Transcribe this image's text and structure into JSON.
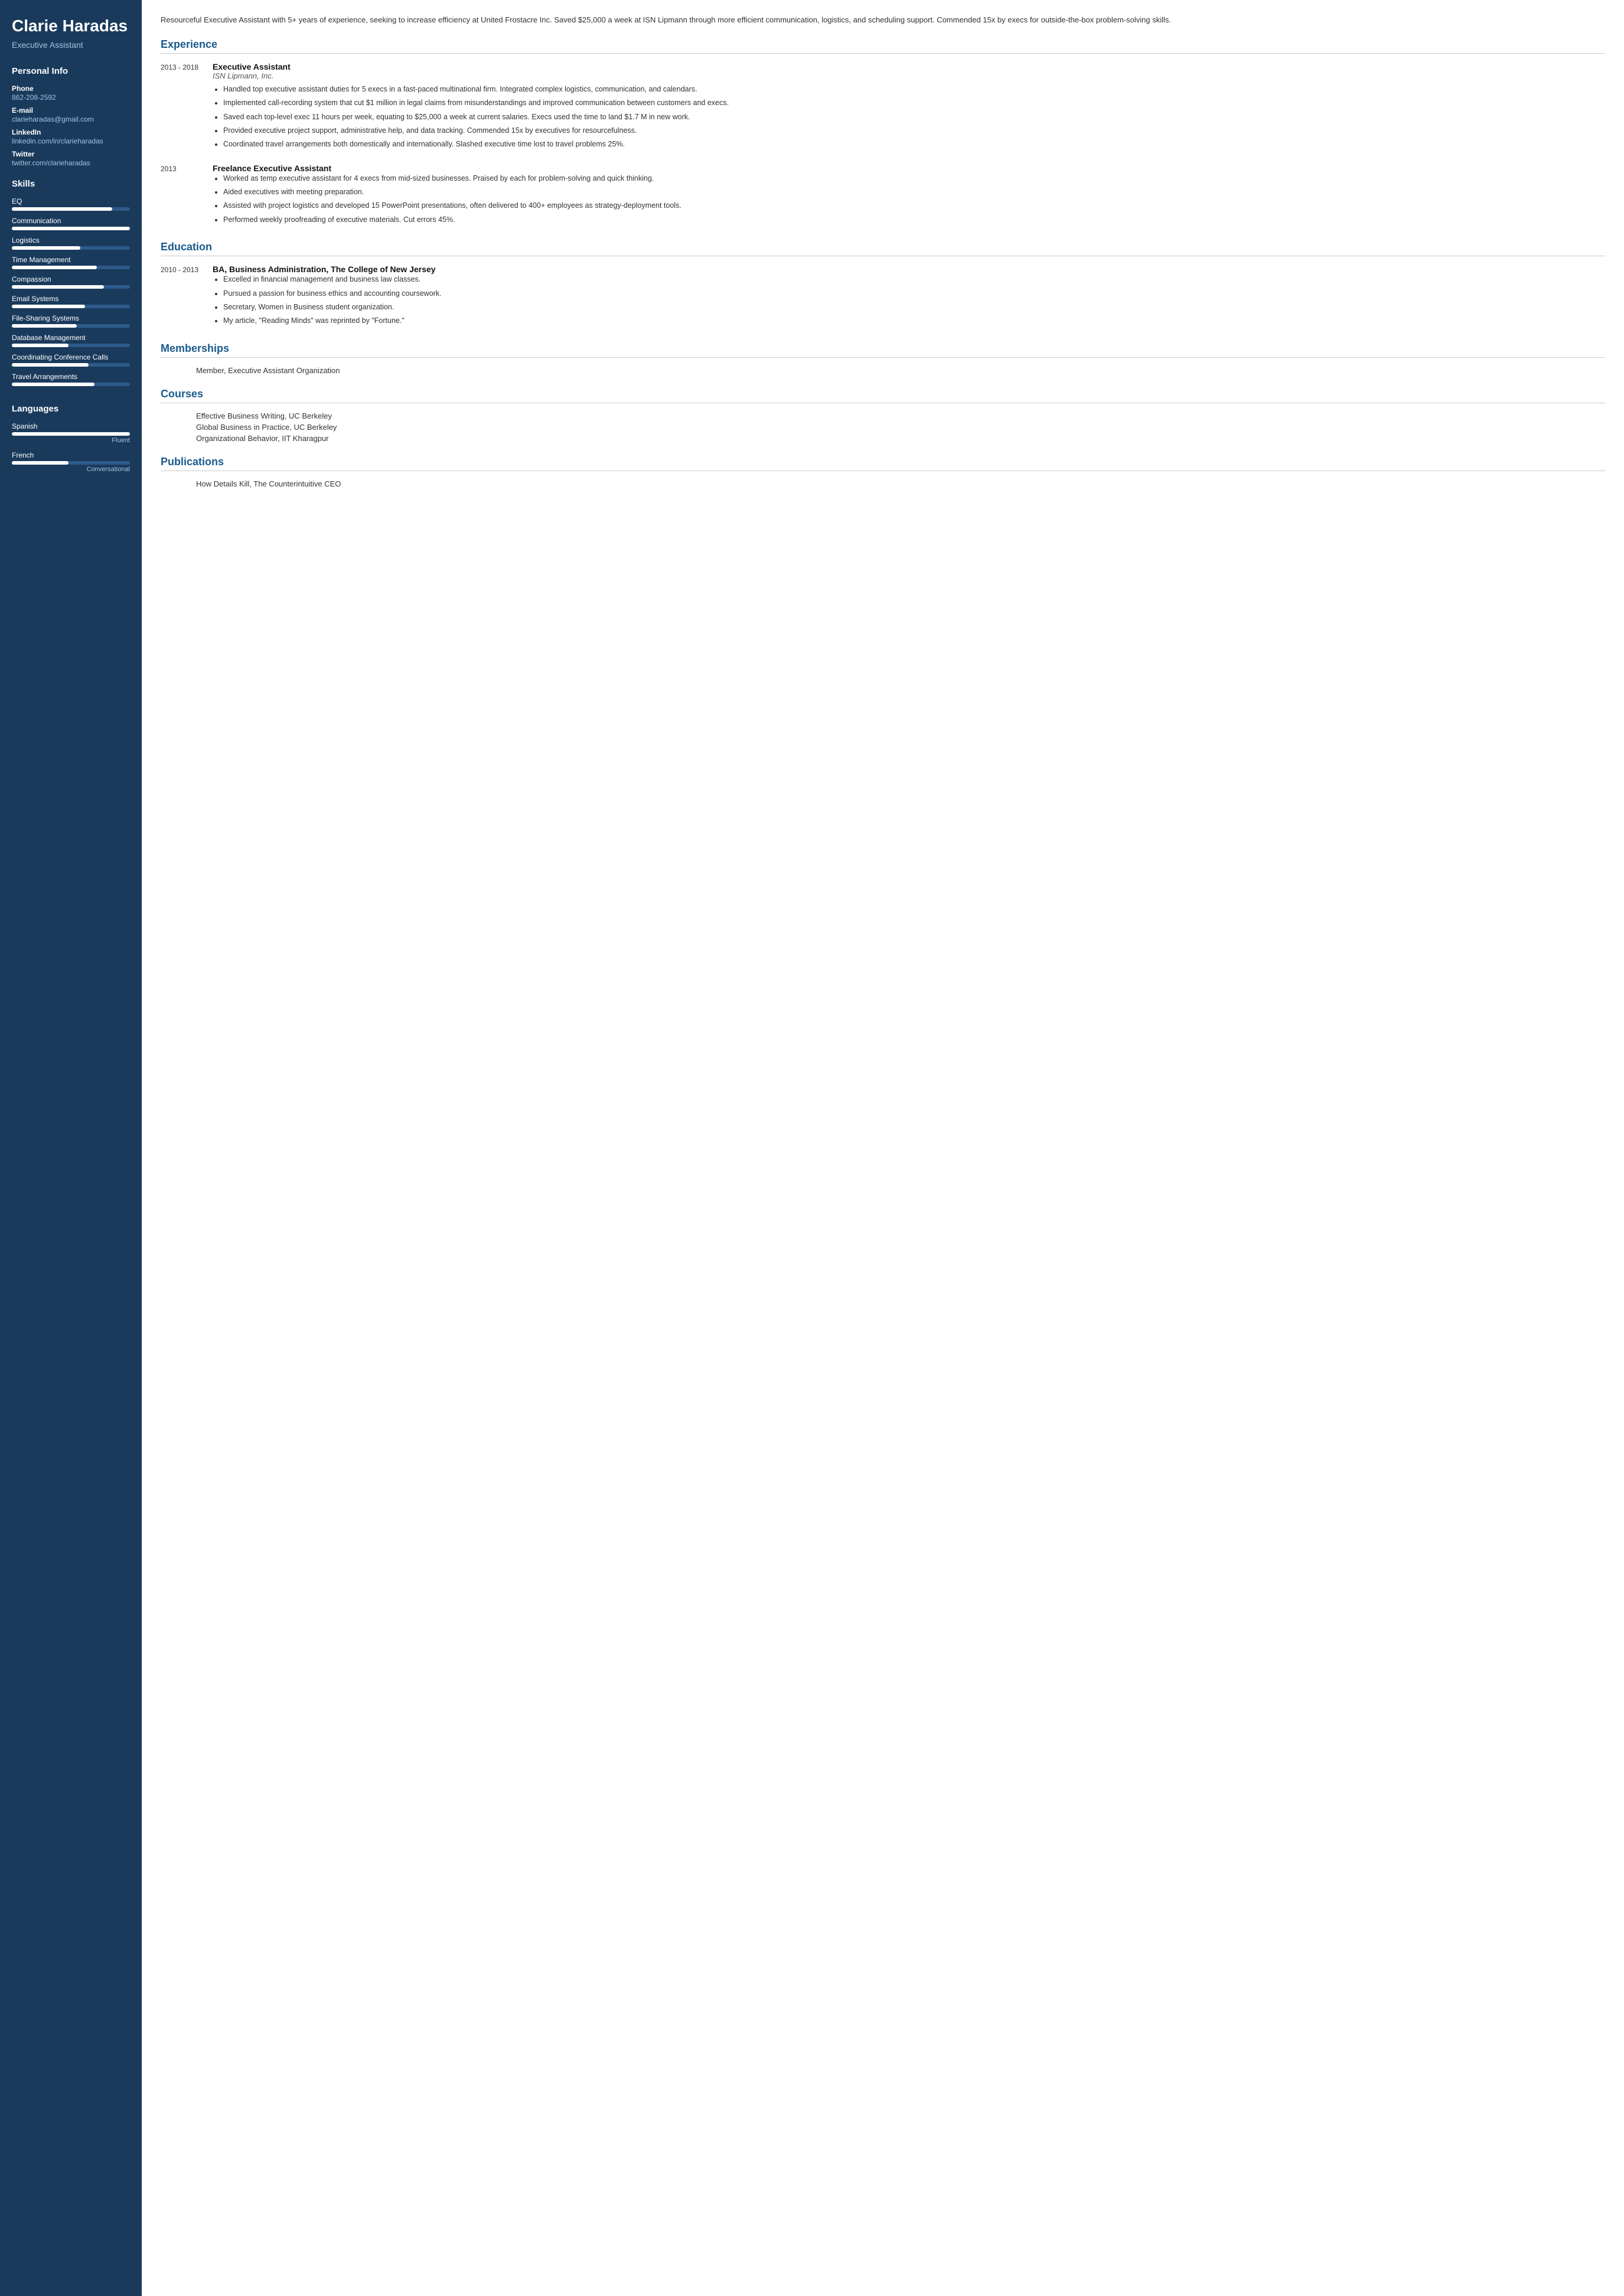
{
  "sidebar": {
    "name": "Clarie Haradas",
    "title": "Executive Assistant",
    "personal_info_label": "Personal Info",
    "phone_label": "Phone",
    "phone": "862-208-2592",
    "email_label": "E-mail",
    "email": "clarieharadas@gmail.com",
    "linkedin_label": "LinkedIn",
    "linkedin": "linkedin.com/in/clarieharadas",
    "twitter_label": "Twitter",
    "twitter": "twitter.com/clarieharadas",
    "skills_label": "Skills",
    "skills": [
      {
        "name": "EQ",
        "pct": 85
      },
      {
        "name": "Communication",
        "pct": 100
      },
      {
        "name": "Logistics",
        "pct": 58
      },
      {
        "name": "Time Management",
        "pct": 72
      },
      {
        "name": "Compassion",
        "pct": 78
      },
      {
        "name": "Email Systems",
        "pct": 62
      },
      {
        "name": "File-Sharing Systems",
        "pct": 55
      },
      {
        "name": "Database Management",
        "pct": 48
      },
      {
        "name": "Coordinating Conference Calls",
        "pct": 65
      },
      {
        "name": "Travel Arrangements",
        "pct": 70
      }
    ],
    "languages_label": "Languages",
    "languages": [
      {
        "name": "Spanish",
        "pct": 100,
        "level": "Fluent"
      },
      {
        "name": "French",
        "pct": 48,
        "level": "Conversational"
      }
    ]
  },
  "main": {
    "summary": "Resourceful Executive Assistant with 5+ years of experience, seeking to increase efficiency at United Frostacre Inc. Saved $25,000 a week at ISN Lipmann through more efficient communication, logistics, and scheduling support. Commended 15x by execs for outside-the-box problem-solving skills.",
    "experience_label": "Experience",
    "experiences": [
      {
        "years": "2013 - 2018",
        "title": "Executive Assistant",
        "company": "ISN Lipmann, Inc.",
        "bullets": [
          "Handled top executive assistant duties for 5 execs in a fast-paced multinational firm. Integrated complex logistics, communication, and calendars.",
          "Implemented call-recording system that cut $1 million in legal claims from misunderstandings and improved communication between customers and execs.",
          "Saved each top-level exec 11 hours per week, equating to $25,000 a week at current salaries. Execs used the time to land $1.7 M in new work.",
          "Provided executive project support, administrative help, and data tracking. Commended 15x by executives for resourcefulness.",
          "Coordinated travel arrangements both domestically and internationally. Slashed executive time lost to travel problems 25%."
        ]
      },
      {
        "years": "2013",
        "title": "Freelance Executive Assistant",
        "company": "",
        "bullets": [
          "Worked as temp executive assistant for 4 execs from mid-sized businesses. Praised by each for problem-solving and quick thinking.",
          "Aided executives with meeting preparation.",
          "Assisted with project logistics and developed 15 PowerPoint presentations, often delivered to 400+ employees as strategy-deployment tools.",
          "Performed weekly proofreading of executive materials. Cut errors 45%."
        ]
      }
    ],
    "education_label": "Education",
    "education": [
      {
        "years": "2010 - 2013",
        "degree": "BA, Business Administration, The College of New Jersey",
        "bullets": [
          "Excelled in financial management and business law classes.",
          "Pursued a passion for business ethics and accounting coursework.",
          "Secretary, Women in Business student organization.",
          "My article, \"Reading Minds\" was reprinted by \"Fortune.\""
        ]
      }
    ],
    "memberships_label": "Memberships",
    "memberships": [
      "Member, Executive Assistant Organization"
    ],
    "courses_label": "Courses",
    "courses": [
      "Effective Business Writing, UC Berkeley",
      "Global Business in Practice, UC Berkeley",
      "Organizational Behavior, IIT Kharagpur"
    ],
    "publications_label": "Publications",
    "publications": [
      "How Details Kill, The Counterintuitive CEO"
    ]
  }
}
